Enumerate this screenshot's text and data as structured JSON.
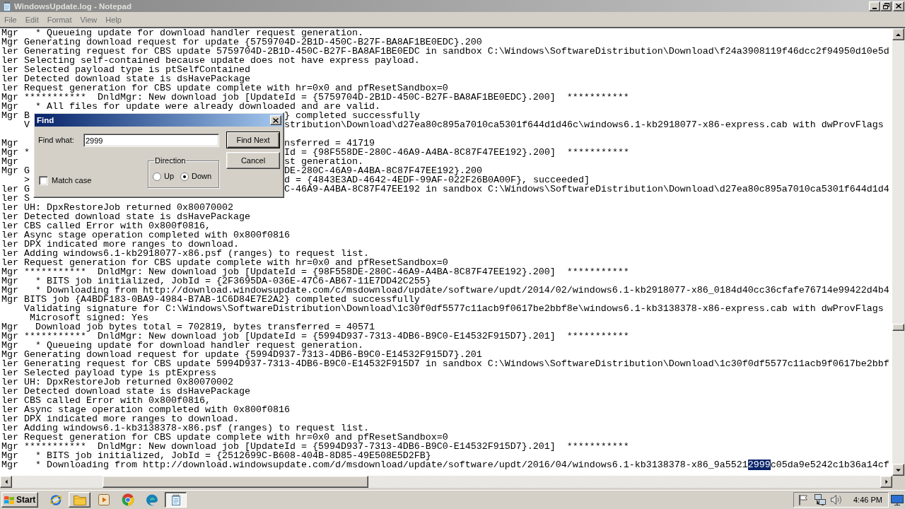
{
  "window": {
    "title": "WindowsUpdate.log - Notepad",
    "active": false
  },
  "menu": [
    "File",
    "Edit",
    "Format",
    "View",
    "Help"
  ],
  "editor": {
    "lines": [
      {
        "kind": "plain",
        "text": "Mgr   * Queueing update for download handler request generation."
      },
      {
        "kind": "plain",
        "text": "Mgr Generating download request for update {5759704D-2B1D-450C-B27F-BA8AF1BE0EDC}.200"
      },
      {
        "kind": "plain",
        "text": "ler Generating request for CBS update 5759704D-2B1D-450C-B27F-BA8AF1BE0EDC in sandbox C:\\Windows\\SoftwareDistribution\\Download\\f24a3908119f46dcc2f94950d10e5d"
      },
      {
        "kind": "plain",
        "text": "ler Selecting self-contained because update does not have express payload."
      },
      {
        "kind": "plain",
        "text": "ler Selected payload type is ptSelfContained"
      },
      {
        "kind": "plain",
        "text": "ler Detected download state is dsHavePackage"
      },
      {
        "kind": "plain",
        "text": "ler Request generation for CBS update complete with hr=0x0 and pfResetSandbox=0"
      },
      {
        "kind": "plain",
        "text": "Mgr ***********  DnldMgr: New download job [UpdateId = {5759704D-2B1D-450C-B27F-BA8AF1BE0EDC}.200]  ***********"
      },
      {
        "kind": "plain",
        "text": "Mgr   * All files for update were already downloaded and are valid."
      },
      {
        "kind": "covered",
        "left": "Mgr B",
        "right": "} completed successfully"
      },
      {
        "kind": "covered",
        "left": "    V",
        "right": "stribution\\Download\\d27ea80c895a7010ca5301f644d1d46c\\windows6.1-kb2918077-x86-express.cab with dwProvFlags"
      },
      {
        "kind": "covered"
      },
      {
        "kind": "covered",
        "left": "Mgr",
        "right": "nsferred = 41719"
      },
      {
        "kind": "covered",
        "left": "Mgr *",
        "right": "Id = {98F558DE-280C-46A9-A4BA-8C87F47EE192}.200]  ***********"
      },
      {
        "kind": "covered",
        "left": "Mgr",
        "right": "st generation."
      },
      {
        "kind": "covered",
        "left": "Mgr G",
        "right": "DE-280C-46A9-A4BA-8C87F47EE192}.200"
      },
      {
        "kind": "covered",
        "left": "    >",
        "right": "d = {4843E3AD-4642-4EDF-99AF-022F26B0A00F}, succeeded]"
      },
      {
        "kind": "covered",
        "left": "ler G",
        "right": "C-46A9-A4BA-8C87F47EE192 in sandbox C:\\Windows\\SoftwareDistribution\\Download\\d27ea80c895a7010ca5301f644d1d4"
      },
      {
        "kind": "covered",
        "left": "ler S"
      },
      {
        "kind": "plain",
        "text": "ler UH: DpxRestoreJob returned 0x80070002"
      },
      {
        "kind": "plain",
        "text": "ler Detected download state is dsHavePackage"
      },
      {
        "kind": "plain",
        "text": "ler CBS called Error with 0x800f0816,"
      },
      {
        "kind": "plain",
        "text": "ler Async stage operation completed with 0x800f0816"
      },
      {
        "kind": "plain",
        "text": "ler DPX indicated more ranges to download."
      },
      {
        "kind": "plain",
        "text": "ler Adding windows6.1-kb2918077-x86.psf (ranges) to request list."
      },
      {
        "kind": "plain",
        "text": "ler Request generation for CBS update complete with hr=0x0 and pfResetSandbox=0"
      },
      {
        "kind": "plain",
        "text": "Mgr ***********  DnldMgr: New download job [UpdateId = {98F558DE-280C-46A9-A4BA-8C87F47EE192}.200]  ***********"
      },
      {
        "kind": "plain",
        "text": "Mgr   * BITS job initialized, JobId = {2F3695DA-036E-47C6-AB67-11E7DD42C255}"
      },
      {
        "kind": "plain",
        "text": "Mgr   * Downloading from http://download.windowsupdate.com/c/msdownload/update/software/updt/2014/02/windows6.1-kb2918077-x86_0184d40cc36cfafe76714e99422d4b4"
      },
      {
        "kind": "plain",
        "text": "Mgr BITS job {A4BDF183-0BA9-4984-B7AB-1C6D84E7E2A2} completed successfully"
      },
      {
        "kind": "plain",
        "text": "    Validating signature for C:\\Windows\\SoftwareDistribution\\Download\\1c30f0df5577c11acb9f0617be2bbf8e\\windows6.1-kb3138378-x86-express.cab with dwProvFlags"
      },
      {
        "kind": "plain",
        "text": "     Microsoft signed: Yes"
      },
      {
        "kind": "plain",
        "text": "Mgr   Download job bytes total = 702819, bytes transferred = 40571"
      },
      {
        "kind": "plain",
        "text": "Mgr ***********  DnldMgr: New download job [UpdateId = {5994D937-7313-4DB6-B9C0-E14532F915D7}.201]  ***********"
      },
      {
        "kind": "plain",
        "text": "Mgr   * Queueing update for download handler request generation."
      },
      {
        "kind": "plain",
        "text": "Mgr Generating download request for update {5994D937-7313-4DB6-B9C0-E14532F915D7}.201"
      },
      {
        "kind": "plain",
        "text": "ler Generating request for CBS update 5994D937-7313-4DB6-B9C0-E14532F915D7 in sandbox C:\\Windows\\SoftwareDistribution\\Download\\1c30f0df5577c11acb9f0617be2bbf"
      },
      {
        "kind": "plain",
        "text": "ler Selected payload type is ptExpress"
      },
      {
        "kind": "plain",
        "text": "ler UH: DpxRestoreJob returned 0x80070002"
      },
      {
        "kind": "plain",
        "text": "ler Detected download state is dsHavePackage"
      },
      {
        "kind": "plain",
        "text": "ler CBS called Error with 0x800f0816,"
      },
      {
        "kind": "plain",
        "text": "ler Async stage operation completed with 0x800f0816"
      },
      {
        "kind": "plain",
        "text": "ler DPX indicated more ranges to download."
      },
      {
        "kind": "plain",
        "text": "ler Adding windows6.1-kb3138378-x86.psf (ranges) to request list."
      },
      {
        "kind": "plain",
        "text": "ler Request generation for CBS update complete with hr=0x0 and pfResetSandbox=0"
      },
      {
        "kind": "plain",
        "text": "Mgr ***********  DnldMgr: New download job [UpdateId = {5994D937-7313-4DB6-B9C0-E14532F915D7}.201]  ***********"
      },
      {
        "kind": "plain",
        "text": "Mgr   * BITS job initialized, JobId = {2512699C-B608-404B-8D85-49E508E5D2FB}"
      },
      {
        "kind": "match",
        "segments": [
          {
            "text": "Mgr   * Downloading from http://download.windowsupdate.com/d/msdownload/update/software/updt/2016/04/windows6.1-kb3138378-x86_9a5521",
            "selected": false
          },
          {
            "text": "2999",
            "selected": true
          },
          {
            "text": "c05da9e5242c1b36a14cf",
            "selected": false
          }
        ]
      }
    ]
  },
  "find_dialog": {
    "title": "Find",
    "find_what": {
      "label": "Find what:",
      "value": "2999"
    },
    "match_case": {
      "label": "Match case",
      "checked": false
    },
    "direction": {
      "title": "Direction",
      "options": [
        {
          "label": "Up",
          "selected": false
        },
        {
          "label": "Down",
          "selected": true
        }
      ]
    },
    "buttons": [
      {
        "label": "Find Next",
        "default": true
      },
      {
        "label": "Cancel",
        "default": false
      }
    ]
  },
  "taskbar": {
    "start": "Start",
    "apps": [
      {
        "kind": "browser",
        "open": false,
        "selected": false
      },
      {
        "kind": "folder",
        "open": true,
        "selected": false
      },
      {
        "kind": "media",
        "open": false,
        "selected": false
      },
      {
        "kind": "ring",
        "open": false,
        "selected": false
      },
      {
        "kind": "swirl",
        "open": false,
        "selected": false
      },
      {
        "kind": "notepad",
        "open": true,
        "selected": true
      }
    ],
    "clock": "4:46 PM"
  }
}
